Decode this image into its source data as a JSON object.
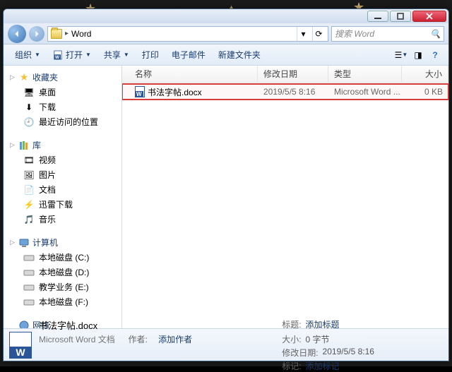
{
  "path": {
    "root_icon": "folder",
    "segment": "Word"
  },
  "search": {
    "placeholder": "搜索 Word"
  },
  "toolbar": {
    "organize": "组织",
    "open": "打开",
    "share": "共享",
    "print": "打印",
    "email": "电子邮件",
    "new_folder": "新建文件夹"
  },
  "sidebar": {
    "favorites": {
      "label": "收藏夹",
      "items": [
        "桌面",
        "下载",
        "最近访问的位置"
      ]
    },
    "libraries": {
      "label": "库",
      "items": [
        "视频",
        "图片",
        "文档",
        "迅雷下载",
        "音乐"
      ]
    },
    "computer": {
      "label": "计算机",
      "drives": [
        "本地磁盘 (C:)",
        "本地磁盘 (D:)",
        "教学业务 (E:)",
        "本地磁盘 (F:)"
      ]
    },
    "network": {
      "label": "网络"
    }
  },
  "columns": {
    "name": "名称",
    "date": "修改日期",
    "type": "类型",
    "size": "大小"
  },
  "files": [
    {
      "name": "书法字帖.docx",
      "date": "2019/5/5 8:16",
      "type": "Microsoft Word ...",
      "size": "0 KB"
    }
  ],
  "details": {
    "filename": "书法字帖.docx",
    "filetype": "Microsoft Word 文档",
    "tags_label": "标题:",
    "tags_value": "添加标题",
    "author_label": "作者:",
    "author_value": "添加作者",
    "dim_label": "大小:",
    "dim_value": "0 字节",
    "mod_label": "修改日期:",
    "mod_value": "2019/5/5 8:16",
    "mark_label": "标记:",
    "mark_value": "添加标记"
  }
}
